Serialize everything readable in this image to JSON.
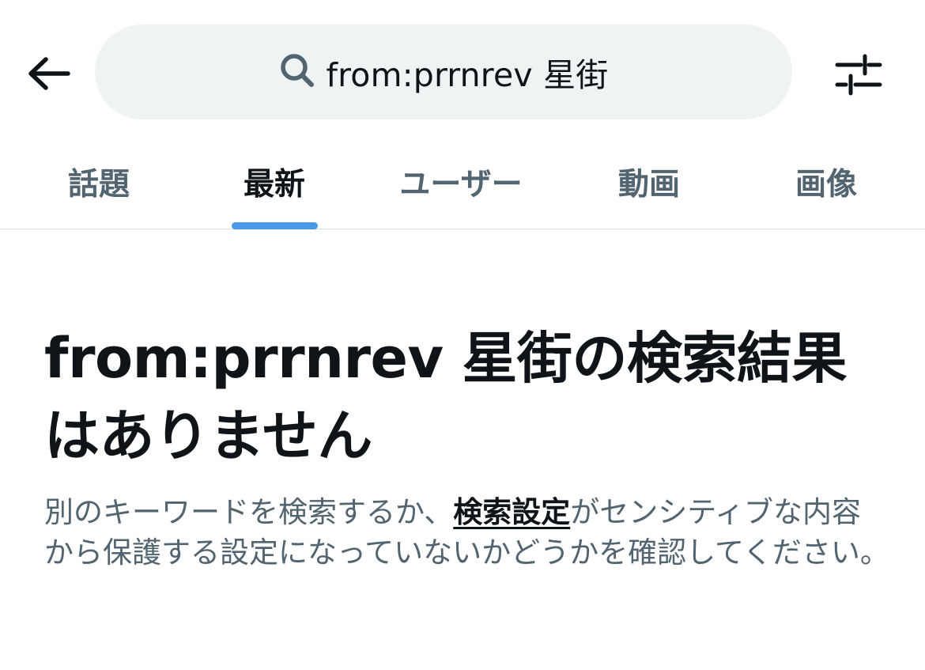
{
  "search": {
    "query": "from:prrnrev 星街"
  },
  "tabs": [
    {
      "label": "話題",
      "active": false
    },
    {
      "label": "最新",
      "active": true
    },
    {
      "label": "ユーザー",
      "active": false
    },
    {
      "label": "動画",
      "active": false
    },
    {
      "label": "画像",
      "active": false
    }
  ],
  "empty_state": {
    "title": "from:prrnrev 星街の検索結果はありません",
    "desc_before": "別のキーワードを検索するか、",
    "link": "検索設定",
    "desc_after": "がセンシティブな内容から保護する設定になっていないかどうかを確認してください。"
  },
  "icons": {
    "back": "arrow-left-icon",
    "search": "search-icon",
    "filter": "sliders-icon"
  },
  "colors": {
    "accent": "#4a99e9",
    "text_primary": "#0f1419",
    "text_secondary": "#536471",
    "search_bg": "#eff3f4"
  }
}
